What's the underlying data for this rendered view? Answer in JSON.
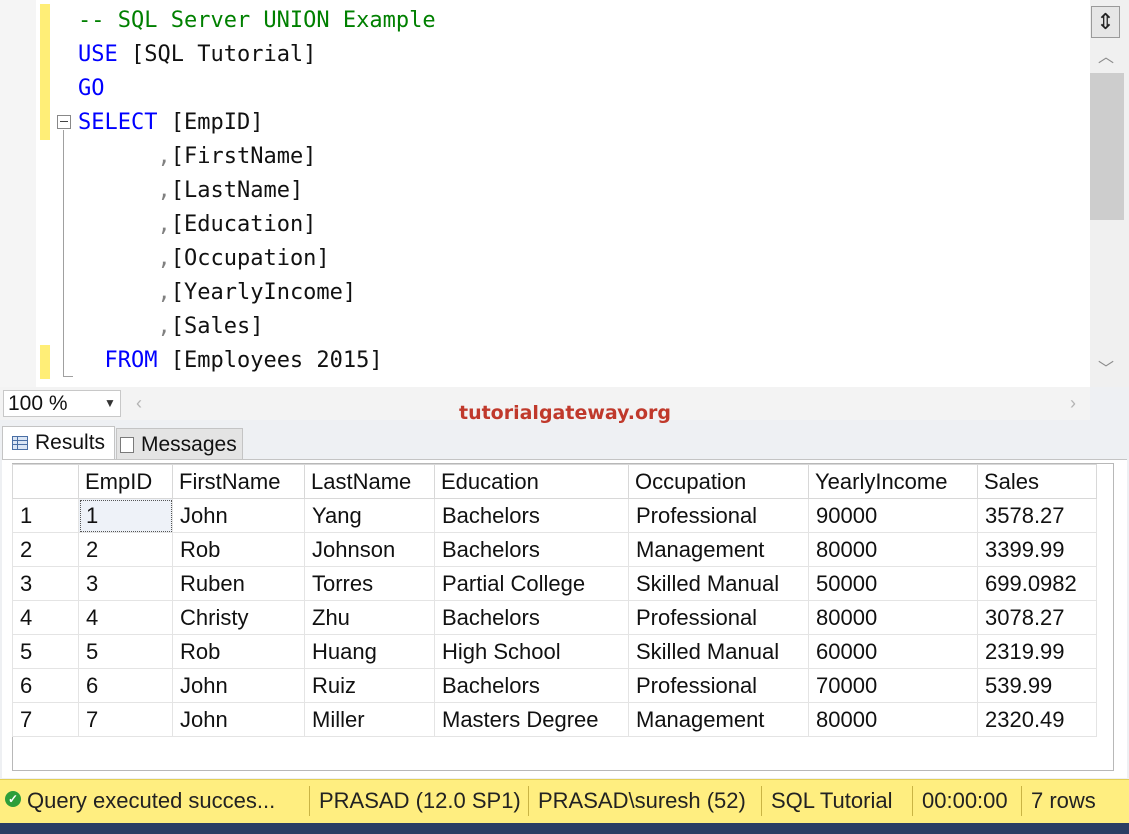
{
  "editor": {
    "lines": [
      {
        "parts": [
          {
            "t": "-- SQL Server UNION Example",
            "c": "cm"
          }
        ]
      },
      {
        "parts": [
          {
            "t": "USE",
            "c": "kw"
          },
          {
            "t": " [SQL Tutorial]",
            "c": ""
          }
        ]
      },
      {
        "parts": [
          {
            "t": "GO",
            "c": "kw"
          }
        ]
      },
      {
        "parts": [
          {
            "t": "SELECT",
            "c": "kw"
          },
          {
            "t": " [EmpID]",
            "c": ""
          }
        ]
      },
      {
        "parts": [
          {
            "t": "      ",
            "c": ""
          },
          {
            "t": ",",
            "c": "gy"
          },
          {
            "t": "[FirstName]",
            "c": ""
          }
        ]
      },
      {
        "parts": [
          {
            "t": "      ",
            "c": ""
          },
          {
            "t": ",",
            "c": "gy"
          },
          {
            "t": "[LastName]",
            "c": ""
          }
        ]
      },
      {
        "parts": [
          {
            "t": "      ",
            "c": ""
          },
          {
            "t": ",",
            "c": "gy"
          },
          {
            "t": "[Education]",
            "c": ""
          }
        ]
      },
      {
        "parts": [
          {
            "t": "      ",
            "c": ""
          },
          {
            "t": ",",
            "c": "gy"
          },
          {
            "t": "[Occupation]",
            "c": ""
          }
        ]
      },
      {
        "parts": [
          {
            "t": "      ",
            "c": ""
          },
          {
            "t": ",",
            "c": "gy"
          },
          {
            "t": "[YearlyIncome]",
            "c": ""
          }
        ]
      },
      {
        "parts": [
          {
            "t": "      ",
            "c": ""
          },
          {
            "t": ",",
            "c": "gy"
          },
          {
            "t": "[Sales]",
            "c": ""
          }
        ]
      },
      {
        "parts": [
          {
            "t": "  FROM",
            "c": "kw"
          },
          {
            "t": " [Employees 2015]",
            "c": ""
          }
        ]
      }
    ]
  },
  "zoom": {
    "value": "100 %"
  },
  "brand": "tutorialgateway.org",
  "tabs": {
    "results": "Results",
    "messages": "Messages"
  },
  "results": {
    "columns": [
      "",
      "EmpID",
      "FirstName",
      "LastName",
      "Education",
      "Occupation",
      "YearlyIncome",
      "Sales"
    ],
    "rows": [
      [
        "1",
        "1",
        "John",
        "Yang",
        "Bachelors",
        "Professional",
        "90000",
        "3578.27"
      ],
      [
        "2",
        "2",
        "Rob",
        "Johnson",
        "Bachelors",
        "Management",
        "80000",
        "3399.99"
      ],
      [
        "3",
        "3",
        "Ruben",
        "Torres",
        "Partial College",
        "Skilled Manual",
        "50000",
        "699.0982"
      ],
      [
        "4",
        "4",
        "Christy",
        "Zhu",
        "Bachelors",
        "Professional",
        "80000",
        "3078.27"
      ],
      [
        "5",
        "5",
        "Rob",
        "Huang",
        "High School",
        "Skilled Manual",
        "60000",
        "2319.99"
      ],
      [
        "6",
        "6",
        "John",
        "Ruiz",
        "Bachelors",
        "Professional",
        "70000",
        "539.99"
      ],
      [
        "7",
        "7",
        "John",
        "Miller",
        "Masters Degree",
        "Management",
        "80000",
        "2320.49"
      ]
    ]
  },
  "status": {
    "message": "Query executed succes...",
    "server": "PRASAD (12.0 SP1)",
    "user": "PRASAD\\suresh (52)",
    "database": "SQL Tutorial",
    "elapsed": "00:00:00",
    "rows": "7 rows"
  },
  "colors": {
    "keyword": "#0000ff",
    "comment": "#008000",
    "status_bar": "#ffee80",
    "brand": "#c0392b"
  },
  "icons": [
    "split-icon",
    "scroll-up-icon",
    "scroll-down-icon",
    "dropdown-arrow-icon",
    "scroll-left-icon",
    "scroll-right-icon",
    "grid-icon",
    "messages-icon",
    "success-icon"
  ]
}
